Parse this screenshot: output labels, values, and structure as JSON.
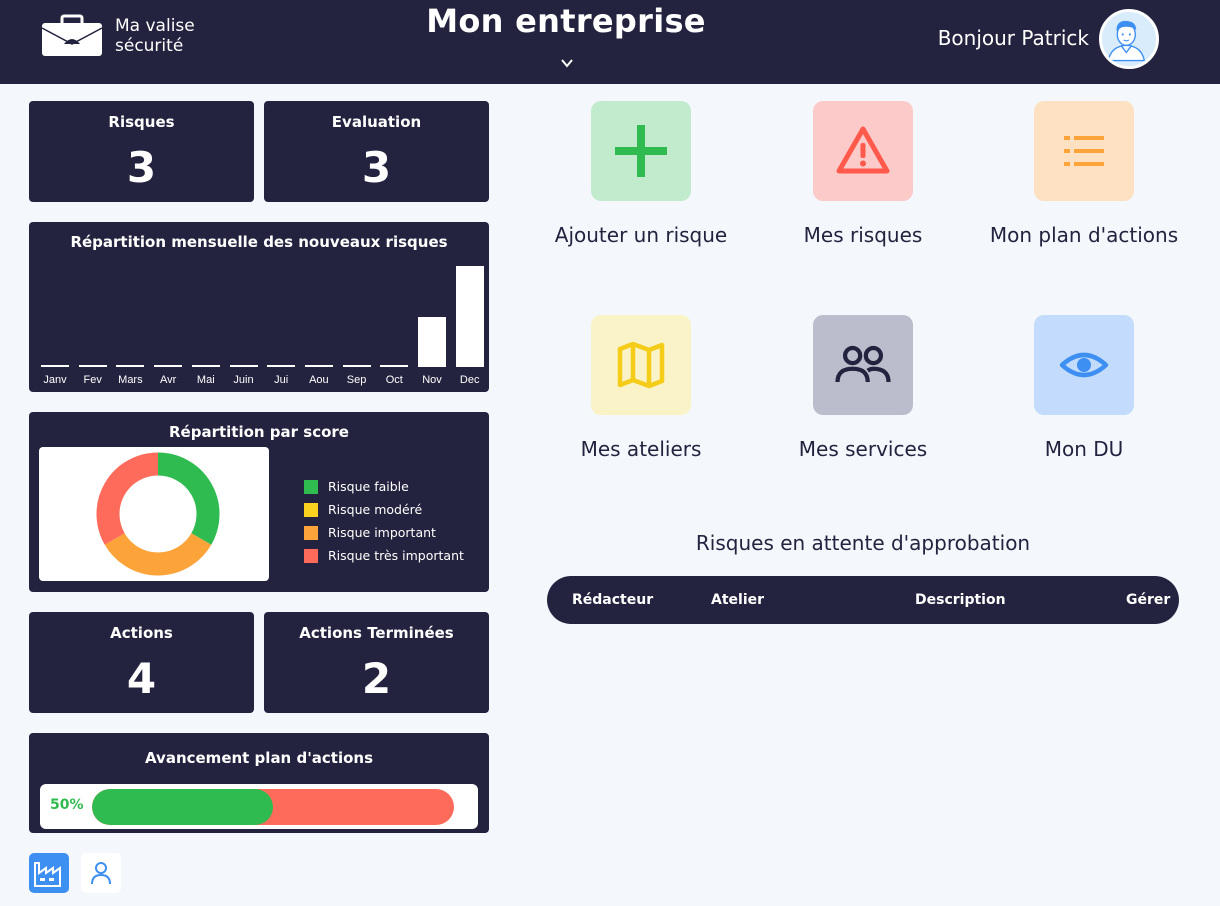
{
  "header": {
    "brand_name": "Ma valise sécurité",
    "title": "Mon entreprise",
    "greeting": "Bonjour Patrick"
  },
  "stats": {
    "risques": {
      "label": "Risques",
      "value": "3"
    },
    "evaluation": {
      "label": "Evaluation",
      "value": "3"
    },
    "actions": {
      "label": "Actions",
      "value": "4"
    },
    "actions_terminees": {
      "label": "Actions Terminées",
      "value": "2"
    }
  },
  "monthly_chart": {
    "title": "Répartition mensuelle des nouveaux risques",
    "months": [
      "Janv",
      "Fev",
      "Mars",
      "Avr",
      "Mai",
      "Juin",
      "Jui",
      "Aou",
      "Sep",
      "Oct",
      "Nov",
      "Dec"
    ]
  },
  "score_chart": {
    "title": "Répartition par score",
    "legend": [
      {
        "label": "Risque faible",
        "color": "#30bb51"
      },
      {
        "label": "Risque modéré",
        "color": "#fad11e"
      },
      {
        "label": "Risque important",
        "color": "#fca33a"
      },
      {
        "label": "Risque très important",
        "color": "#ff6b5b"
      }
    ]
  },
  "progress": {
    "title": "Avancement plan d'actions",
    "percent_label": "50%",
    "value": 0.5,
    "done_color": "#30bb51",
    "remaining_color": "#ff6b5b"
  },
  "tiles": [
    {
      "label": "Ajouter un risque",
      "icon": "plus-icon",
      "bg": "#c2ebce"
    },
    {
      "label": "Mes risques",
      "icon": "warning-icon",
      "bg": "#fccac8"
    },
    {
      "label": "Mon plan d'actions",
      "icon": "list-icon",
      "bg": "#fde1c2"
    },
    {
      "label": "Mes ateliers",
      "icon": "map-icon",
      "bg": "#fbf3c8"
    },
    {
      "label": "Mes services",
      "icon": "users-icon",
      "bg": "#bcbdcc"
    },
    {
      "label": "Mon DU",
      "icon": "eye-icon",
      "bg": "#c3dcfd"
    }
  ],
  "pending": {
    "title": "Risques en attente d'approbation",
    "columns": [
      "Rédacteur",
      "Atelier",
      "Description",
      "Gérer"
    ]
  },
  "chart_data": [
    {
      "type": "bar",
      "title": "Répartition mensuelle des nouveaux risques",
      "categories": [
        "Janv",
        "Fev",
        "Mars",
        "Avr",
        "Mai",
        "Juin",
        "Jui",
        "Aou",
        "Sep",
        "Oct",
        "Nov",
        "Dec"
      ],
      "values": [
        0,
        0,
        0,
        0,
        0,
        0,
        0,
        0,
        0,
        0,
        1,
        2
      ],
      "ylim": [
        0,
        2
      ],
      "grid": false,
      "bar_color": "#ffffff"
    },
    {
      "type": "pie",
      "title": "Répartition par score",
      "donut": true,
      "categories": [
        "Risque faible",
        "Risque modéré",
        "Risque important",
        "Risque très important"
      ],
      "values": [
        1,
        0,
        1,
        1
      ],
      "colors": [
        "#30bb51",
        "#fad11e",
        "#fca33a",
        "#ff6b5b"
      ],
      "legend": "right"
    }
  ]
}
